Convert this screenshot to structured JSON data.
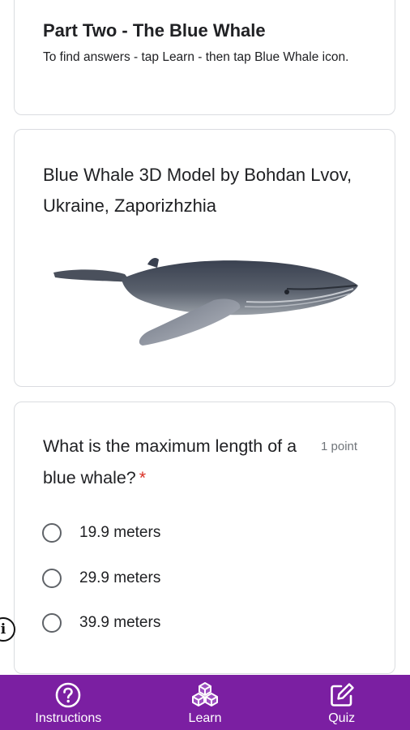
{
  "section": {
    "title": "Part Two - The Blue Whale",
    "description": "To find answers - tap Learn - then tap Blue Whale icon."
  },
  "image_card": {
    "title": "Blue Whale 3D Model by Bohdan Lvov, Ukraine, Zaporizhzhia"
  },
  "question": {
    "text": "What is the maximum length of a blue whale?",
    "required_mark": "*",
    "points": "1 point",
    "options": [
      {
        "label": "19.9 meters"
      },
      {
        "label": "29.9 meters"
      },
      {
        "label": "39.9 meters"
      }
    ]
  },
  "bottom_nav": {
    "items": [
      {
        "label": "Instructions",
        "icon": "question-circle-icon"
      },
      {
        "label": "Learn",
        "icon": "blocks-icon"
      },
      {
        "label": "Quiz",
        "icon": "edit-square-icon"
      }
    ]
  },
  "colors": {
    "nav_background": "#7b1fa2",
    "required": "#d93025",
    "card_border": "#dadce0"
  }
}
